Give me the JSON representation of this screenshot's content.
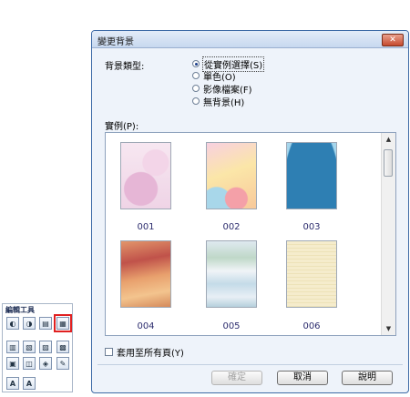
{
  "toolbox": {
    "title": "編輯工具",
    "button_glyphs": [
      "◐",
      "◑",
      "▤",
      "▦",
      "▥",
      "▧",
      "▨",
      "▩",
      "▣",
      "◫",
      "◈",
      "✎",
      "A",
      "A"
    ]
  },
  "dialog": {
    "title": "變更背景",
    "close_label": "✕",
    "bg_type_label": "背景類型:",
    "options": [
      "從實例選擇(S)",
      "單色(O)",
      "影像檔案(F)",
      "無背景(H)"
    ],
    "selected_option": 0,
    "sample_label": "實例(P):",
    "thumbnails": [
      "001",
      "002",
      "003",
      "004",
      "005",
      "006"
    ],
    "selected_thumbnail": "001",
    "apply_all_label": "套用至所有頁(Y)",
    "buttons": {
      "ok": "確定",
      "cancel": "取消",
      "help": "說明"
    },
    "scroll_up": "▲",
    "scroll_down": "▼"
  },
  "colors": {
    "accent": "#3d6aa6",
    "highlight": "#e02020",
    "selection": "#c8d9f2"
  }
}
